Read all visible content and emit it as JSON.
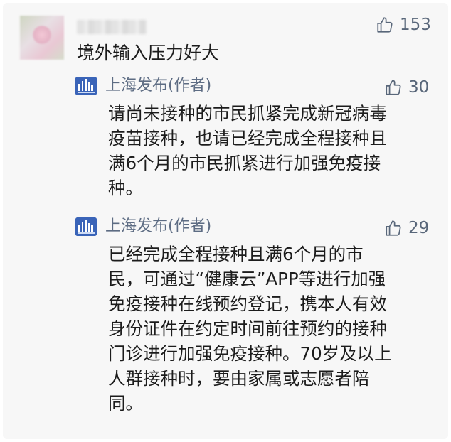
{
  "comment": {
    "text": "境外输入压力好大",
    "likes": "153"
  },
  "replies": [
    {
      "author": "上海发布(作者)",
      "likes": "30",
      "lines": [
        "请尚未接种的市民抓紧完成新冠病毒",
        "疫苗接种，也请已经完成全程接种且",
        "满6个月的市民抓紧进行加强免疫接",
        "种。"
      ]
    },
    {
      "author": "上海发布(作者)",
      "likes": "29",
      "lines": [
        "已经完成全程接种且满6个月的市",
        "民，可通过“健康云”APP等进行加强",
        "免疫接种在线预约登记，携本人有效",
        "身份证件在约定时间前往预约的接种",
        "门诊进行加强免疫接种。70岁及以上",
        "人群接种时，要由家属或志愿者陪",
        "同。"
      ]
    }
  ],
  "icons": {
    "like": "thumbs-up-icon",
    "author_avatar": "shanghai-skyline-logo"
  },
  "colors": {
    "name": "#5d6c83",
    "like": "#59677a",
    "text": "#1c1c1c",
    "logo": "#3a64b8"
  }
}
